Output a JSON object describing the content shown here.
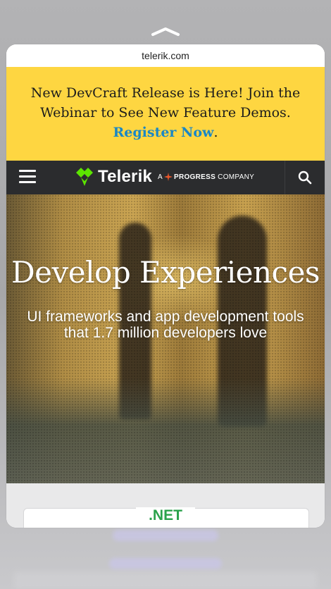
{
  "browser": {
    "url": "telerik.com"
  },
  "promo": {
    "line1": "New DevCraft Release is Here! Join the",
    "line2": "Webinar to See New Feature Demos.",
    "link": "Register Now",
    "suffix": "."
  },
  "nav": {
    "brand": "Telerik",
    "tag_prefix": "A",
    "tag_brand": "PROGRESS",
    "tag_suffix": "COMPANY",
    "icons": [
      "menu-icon",
      "telerik-logo-icon",
      "search-icon"
    ]
  },
  "hero": {
    "title": "Develop Experiences",
    "subtitle_line1": "UI frameworks and app development tools",
    "subtitle_line2": "that 1.7 million developers love"
  },
  "section": {
    "label": ".NET"
  },
  "colors": {
    "promo_bg": "#fed641",
    "link": "#1a87c5",
    "nav_bg": "#2b2c2e",
    "accent_green": "#2ba24c"
  }
}
